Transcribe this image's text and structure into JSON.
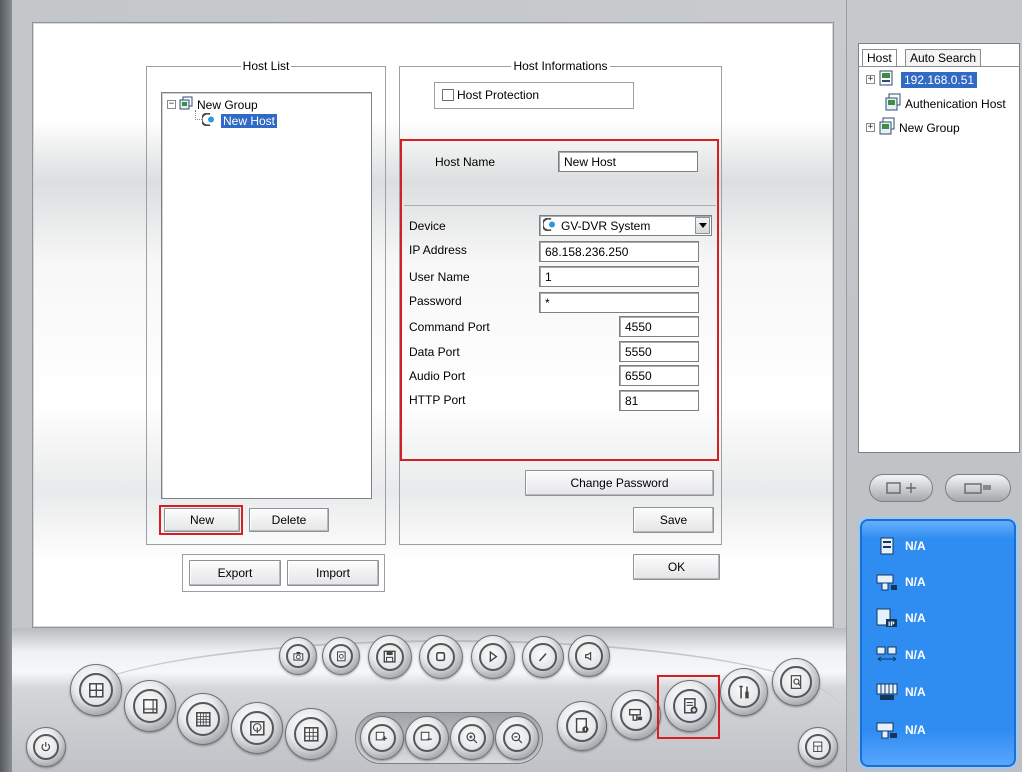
{
  "host_list": {
    "title": "Host List",
    "tree": {
      "group_label": "New Group",
      "host_label": "New Host"
    },
    "new_label": "New",
    "delete_label": "Delete",
    "export_label": "Export",
    "import_label": "Import"
  },
  "host_info": {
    "title": "Host Informations",
    "host_protection_label": "Host Protection",
    "host_name_label": "Host Name",
    "host_name_value": "New Host",
    "device_label": "Device",
    "device_value": "GV-DVR System",
    "ip_label": "IP Address",
    "ip_value": "68.158.236.250",
    "user_label": "User Name",
    "user_value": "1",
    "password_label": "Password",
    "password_value": "*",
    "command_port_label": "Command Port",
    "command_port_value": "4550",
    "data_port_label": "Data Port",
    "data_port_value": "5550",
    "audio_port_label": "Audio Port",
    "audio_port_value": "6550",
    "http_port_label": "HTTP Port",
    "http_port_value": "81",
    "change_password_label": "Change Password",
    "save_label": "Save",
    "ok_label": "OK"
  },
  "right_panel": {
    "tabs": [
      "Host",
      "Auto Search"
    ],
    "tree": {
      "ip_item": "192.168.0.51",
      "auth_item": "Authenication Host",
      "group_item": "New Group"
    },
    "status_items": [
      "N/A",
      "N/A",
      "N/A",
      "N/A",
      "N/A",
      "N/A"
    ]
  },
  "colors": {
    "highlight_red": "#d61f24",
    "selection_blue": "#316ac5",
    "status_panel_blue": "#2f8cf0"
  },
  "icons": {
    "toolbar_row1": [
      "camera-icon",
      "snapshot-icon",
      "save-icon",
      "stop-icon",
      "play-icon",
      "edit-icon",
      "speaker-icon"
    ],
    "toolbar_row2_left": [
      "single-view-icon",
      "quad-view-icon",
      "grid-view-icon",
      "map-icon",
      "multi-view-icon"
    ],
    "toolbar_row2_mid": [
      "zoom-in-area-icon",
      "zoom-out-area-icon",
      "zoom-in-icon",
      "zoom-out-icon"
    ],
    "toolbar_row2_right": [
      "host-info-icon",
      "ptz-icon",
      "add-host-icon",
      "tools-icon",
      "search-icon"
    ],
    "misc": [
      "power-icon",
      "layout-icon"
    ]
  }
}
